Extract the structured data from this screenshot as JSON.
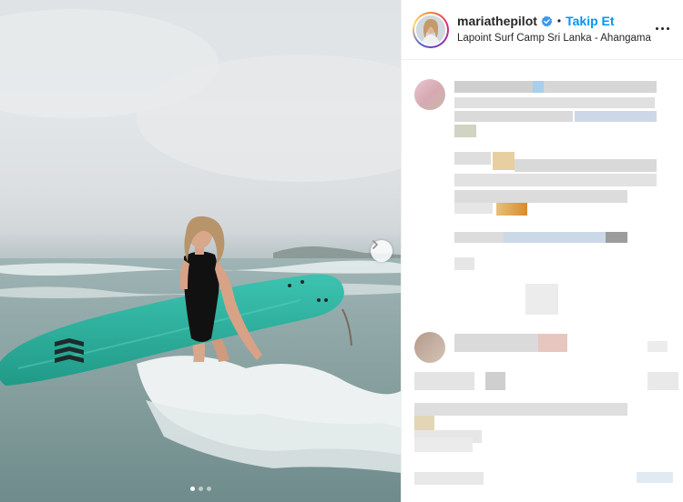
{
  "post": {
    "username": "mariathepilot",
    "follow_label": "Takip Et",
    "separator": "•",
    "location": "Lapoint Surf Camp Sri Lanka - Ahangama",
    "verified": true
  },
  "carousel": {
    "slide_count": 3,
    "active_index": 0
  },
  "icons": {
    "next": "chevron-right-icon",
    "more": "more-options-icon",
    "verified": "verified-badge-icon"
  },
  "colors": {
    "follow_blue": "#0095f6",
    "text": "#262626",
    "surfboard": "#2fb3a0"
  }
}
